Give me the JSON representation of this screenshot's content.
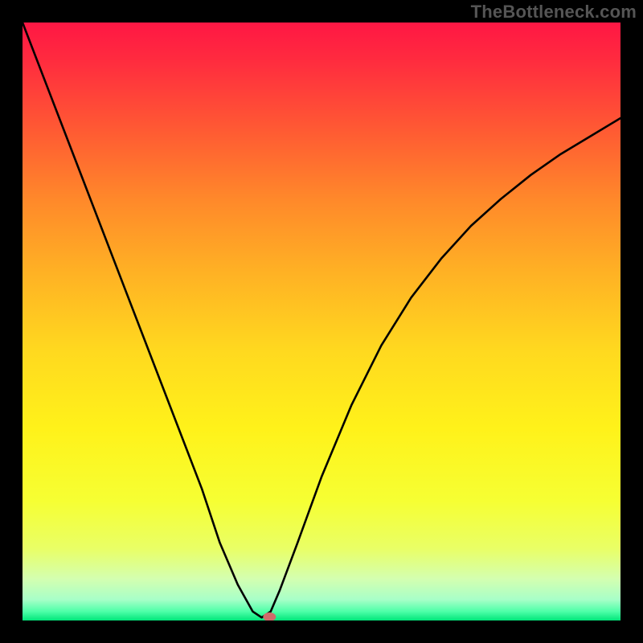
{
  "watermark": "TheBottleneck.com",
  "chart_data": {
    "type": "line",
    "title": "",
    "xlabel": "",
    "ylabel": "",
    "ylim": [
      0,
      100
    ],
    "xlim": [
      0,
      100
    ],
    "legend": [],
    "annotations": [],
    "series": [
      {
        "name": "curve",
        "x": [
          0,
          5,
          10,
          15,
          20,
          25,
          30,
          33,
          36,
          38.5,
          40,
          41.5,
          43,
          46,
          50,
          55,
          60,
          65,
          70,
          75,
          80,
          85,
          90,
          95,
          100
        ],
        "values": [
          100,
          87,
          74,
          61,
          48,
          35,
          22,
          13,
          6,
          1.5,
          0.5,
          1.5,
          5,
          13,
          24,
          36,
          46,
          54,
          60.5,
          66,
          70.5,
          74.5,
          78,
          81,
          84
        ]
      }
    ],
    "marker": {
      "x": 41.3,
      "y": 0.6,
      "color": "#cf6a6a"
    },
    "gradient_stops": [
      {
        "offset": 0.0,
        "color": "#ff1744"
      },
      {
        "offset": 0.06,
        "color": "#ff2a3f"
      },
      {
        "offset": 0.18,
        "color": "#ff5a33"
      },
      {
        "offset": 0.3,
        "color": "#ff8a2a"
      },
      {
        "offset": 0.42,
        "color": "#ffb224"
      },
      {
        "offset": 0.55,
        "color": "#ffd91f"
      },
      {
        "offset": 0.68,
        "color": "#fff21a"
      },
      {
        "offset": 0.8,
        "color": "#f6ff33"
      },
      {
        "offset": 0.88,
        "color": "#e9ff66"
      },
      {
        "offset": 0.93,
        "color": "#d4ffb0"
      },
      {
        "offset": 0.965,
        "color": "#a8ffc8"
      },
      {
        "offset": 0.985,
        "color": "#4dffa8"
      },
      {
        "offset": 1.0,
        "color": "#00e57a"
      }
    ],
    "plot_size": 744
  }
}
